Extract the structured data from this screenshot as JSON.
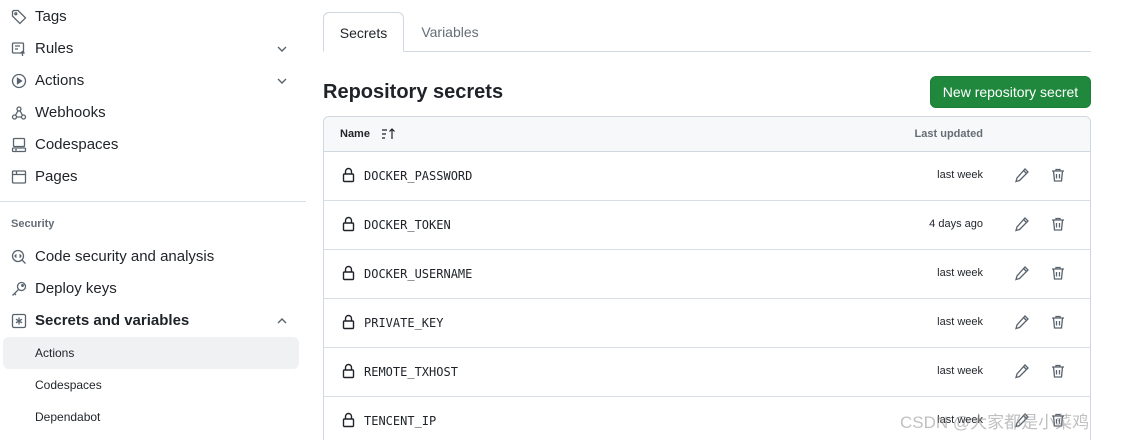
{
  "sidebar": {
    "items": [
      {
        "label": "Tags",
        "icon": "tag-icon"
      },
      {
        "label": "Rules",
        "icon": "rules-icon",
        "chevron": "down"
      },
      {
        "label": "Actions",
        "icon": "play-icon",
        "chevron": "down"
      },
      {
        "label": "Webhooks",
        "icon": "webhook-icon"
      },
      {
        "label": "Codespaces",
        "icon": "codespaces-icon"
      },
      {
        "label": "Pages",
        "icon": "browser-icon"
      }
    ],
    "security_heading": "Security",
    "security_items": [
      {
        "label": "Code security and analysis",
        "icon": "codescan-icon"
      },
      {
        "label": "Deploy keys",
        "icon": "key-icon"
      },
      {
        "label": "Secrets and variables",
        "icon": "asterisk-icon",
        "chevron": "up"
      }
    ],
    "sub_items": [
      {
        "label": "Actions",
        "active": true
      },
      {
        "label": "Codespaces"
      },
      {
        "label": "Dependabot"
      }
    ]
  },
  "tabs": [
    {
      "label": "Secrets",
      "active": true
    },
    {
      "label": "Variables"
    }
  ],
  "page_title": "Repository secrets",
  "new_button_label": "New repository secret",
  "table": {
    "header_name": "Name",
    "header_updated": "Last updated",
    "rows": [
      {
        "name": "DOCKER_PASSWORD",
        "updated": "last week"
      },
      {
        "name": "DOCKER_TOKEN",
        "updated": "4 days ago"
      },
      {
        "name": "DOCKER_USERNAME",
        "updated": "last week"
      },
      {
        "name": "PRIVATE_KEY",
        "updated": "last week"
      },
      {
        "name": "REMOTE_TXHOST",
        "updated": "last week"
      },
      {
        "name": "TENCENT_IP",
        "updated": "last week"
      }
    ]
  },
  "watermark": "CSDN @大家都是小菜鸡",
  "colors": {
    "primary_button": "#1f883d",
    "active_nav_bg": "#f0f1f3",
    "border": "#d0d7de",
    "muted_text": "#656d76"
  }
}
